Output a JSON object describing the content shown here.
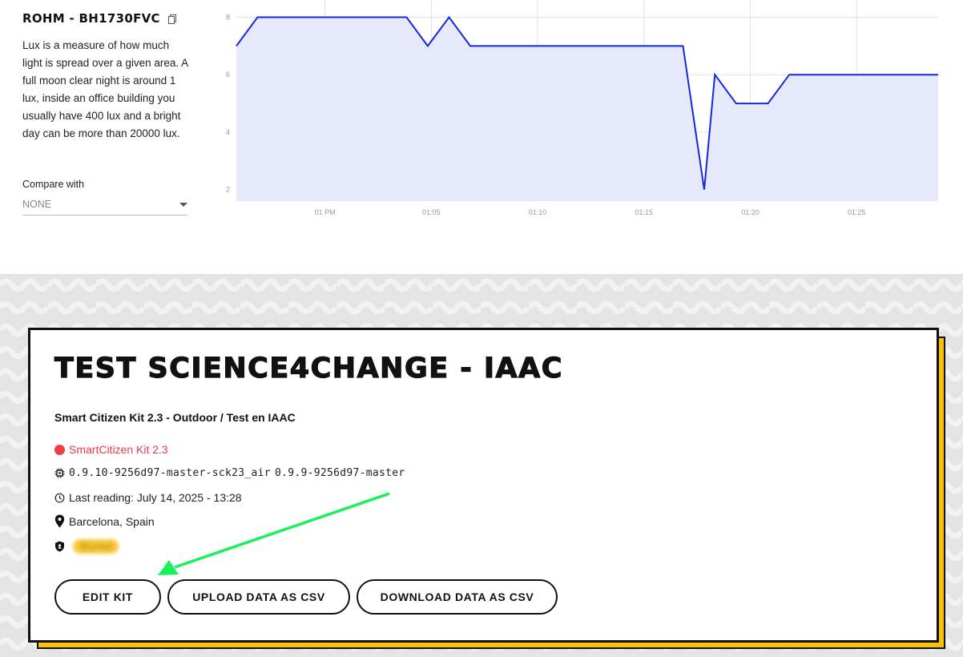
{
  "sensor": {
    "title": "ROHM - BH1730FVC",
    "description": "Lux is a measure of how much light is spread over a given area. A full moon clear night is around 1 lux, inside an office building you usually have 400 lux and a bright day can be more than 20000 lux.",
    "compare_label": "Compare with",
    "compare_value": "NONE"
  },
  "chart_data": {
    "type": "area",
    "title": "",
    "xlabel": "",
    "ylabel": "",
    "x_ticks": [
      "01 PM",
      "01:05",
      "01:10",
      "01:15",
      "01:20",
      "01:25"
    ],
    "y_ticks": [
      "2",
      "4",
      "6",
      "8"
    ],
    "ylim": [
      1.6,
      8.6
    ],
    "xlim": [
      "12:55:50",
      "01:28:50"
    ],
    "x": [
      "12:55:50",
      "12:56:50",
      "01:03:50",
      "01:04:50",
      "01:05:50",
      "01:06:50",
      "01:16:50",
      "01:17:50",
      "01:18:20",
      "01:19:20",
      "01:20:50",
      "01:21:50",
      "01:28:50"
    ],
    "values": [
      7,
      8,
      8,
      7,
      8,
      7,
      7,
      2,
      6,
      5,
      5,
      6,
      6
    ],
    "grid": true,
    "colors": {
      "line": "#1428e0",
      "fill": "#e6e8fc",
      "grid": "#e2e2e2"
    }
  },
  "kit": {
    "title": "TEST SCIENCE4CHANGE - IAAC",
    "description": "Smart Citizen Kit 2.3 - Outdoor / Test en IAAC",
    "type": "SmartCitizen Kit 2.3",
    "firmware": "0.9.10-9256d97-master-sck23_air",
    "firmware_secondary": "0.9.9-9256d97-master",
    "last_reading": "Last reading: July 14, 2025 - 13:28",
    "location": "Barcelona, Spain",
    "badge": "Blurred",
    "type_color": "#e8394b",
    "accent_color": "#f8c10a"
  },
  "buttons": {
    "edit": "EDIT KIT",
    "upload": "UPLOAD DATA AS CSV",
    "download": "DOWNLOAD DATA AS CSV"
  },
  "annotation": {
    "arrow_color": "#19f05a"
  }
}
